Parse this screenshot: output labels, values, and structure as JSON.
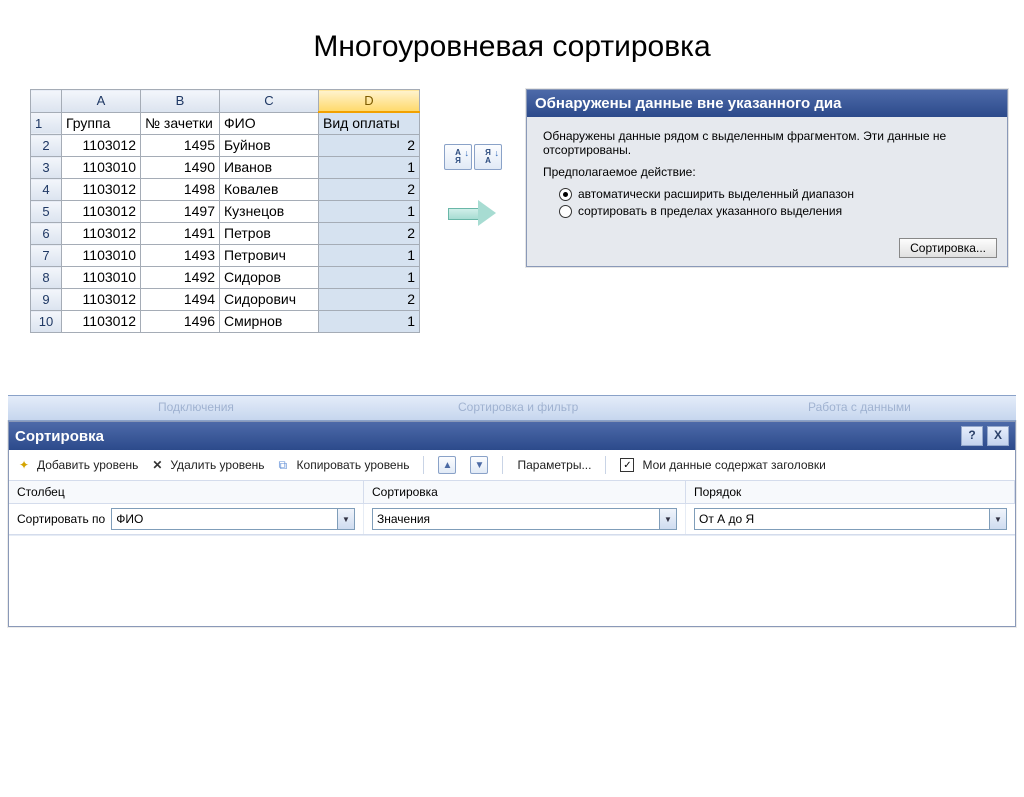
{
  "title": "Многоуровневая сортировка",
  "sheet": {
    "columns": [
      "A",
      "B",
      "C",
      "D"
    ],
    "selected_col_index": 3,
    "headers": {
      "a": "Группа",
      "b": "№ зачетки",
      "c": "ФИО",
      "d": "Вид оплаты"
    },
    "rows": [
      {
        "n": "2",
        "a": "1103012",
        "b": "1495",
        "c": "Буйнов",
        "d": "2"
      },
      {
        "n": "3",
        "a": "1103010",
        "b": "1490",
        "c": "Иванов",
        "d": "1"
      },
      {
        "n": "4",
        "a": "1103012",
        "b": "1498",
        "c": "Ковалев",
        "d": "2"
      },
      {
        "n": "5",
        "a": "1103012",
        "b": "1497",
        "c": "Кузнецов",
        "d": "1"
      },
      {
        "n": "6",
        "a": "1103012",
        "b": "1491",
        "c": "Петров",
        "d": "2"
      },
      {
        "n": "7",
        "a": "1103010",
        "b": "1493",
        "c": "Петрович",
        "d": "1"
      },
      {
        "n": "8",
        "a": "1103010",
        "b": "1492",
        "c": "Сидоров",
        "d": "1"
      },
      {
        "n": "9",
        "a": "1103012",
        "b": "1494",
        "c": "Сидорович",
        "d": "2"
      },
      {
        "n": "10",
        "a": "1103012",
        "b": "1496",
        "c": "Смирнов",
        "d": "1"
      }
    ]
  },
  "sort_btn": {
    "asc": "А\nЯ",
    "desc": "Я\nА"
  },
  "warn": {
    "title": "Обнаружены данные вне указанного диа",
    "text1": "Обнаружены данные рядом с выделенным фрагментом. Эти данные не отсортированы.",
    "text2": "Предполагаемое действие:",
    "opt1": "автоматически расширить выделенный диапазон",
    "opt2": "сортировать в пределах указанного выделения",
    "button": "Сортировка..."
  },
  "ribbon": {
    "a": "Подключения",
    "b": "Сортировка и фильтр",
    "c": "Работа с данными"
  },
  "sortdlg": {
    "title": "Сортировка",
    "help": "?",
    "close": "X",
    "add": "Добавить уровень",
    "del": "Удалить уровень",
    "copy": "Копировать уровень",
    "params": "Параметры...",
    "headers_cb": "Мои данные содержат заголовки",
    "col_col": "Столбец",
    "col_sort": "Сортировка",
    "col_order": "Порядок",
    "row_label": "Сортировать по",
    "row_field": "ФИО",
    "row_sort": "Значения",
    "row_order": "От А до Я"
  }
}
